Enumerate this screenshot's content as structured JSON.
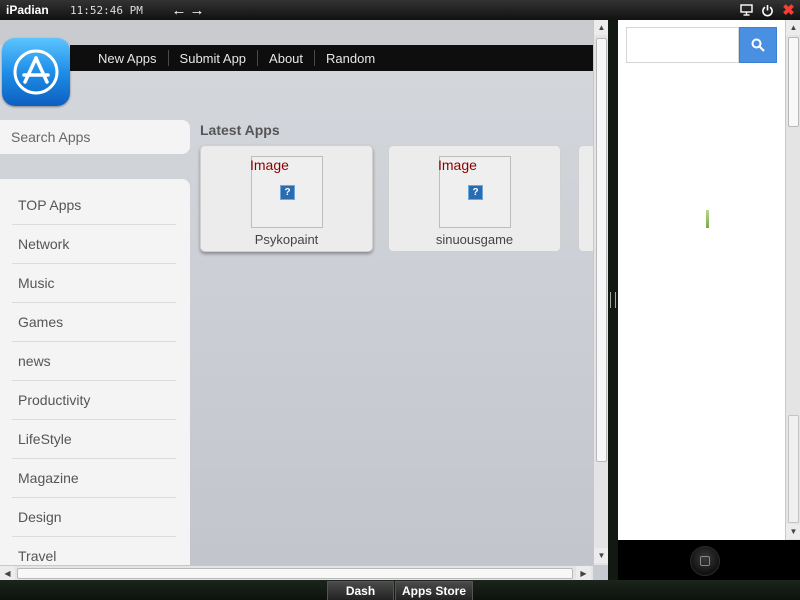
{
  "topbar": {
    "app_name": "iPadian",
    "clock": "11:52:46 PM",
    "icons": [
      "arrow-left-icon",
      "arrow-right-icon",
      "monitor-icon",
      "power-icon",
      "close-icon"
    ]
  },
  "site": {
    "nav": [
      "New Apps",
      "Submit App",
      "About",
      "Random"
    ],
    "search_placeholder": "Search Apps",
    "categories": [
      "TOP Apps",
      "Network",
      "Music",
      "Games",
      "news",
      "Productivity",
      "LifeStyle",
      "Magazine",
      "Design",
      "Travel"
    ],
    "section_title": "Latest Apps",
    "apps": [
      {
        "alt": "Image",
        "broken_icon": "?",
        "name": "Psykopaint"
      },
      {
        "alt": "Image",
        "broken_icon": "?",
        "name": "sinuousgame"
      }
    ]
  },
  "side_panel": {
    "search_value": "",
    "icons": [
      "search-icon",
      "home-button-icon"
    ]
  },
  "taskbar": {
    "items": [
      "Dash",
      "Apps Store"
    ]
  },
  "colors": {
    "nav_bg": "#0e0e0e",
    "search_button": "#4a90e2",
    "alt_text": "#8b0000",
    "close_red": "#ff3b30"
  }
}
